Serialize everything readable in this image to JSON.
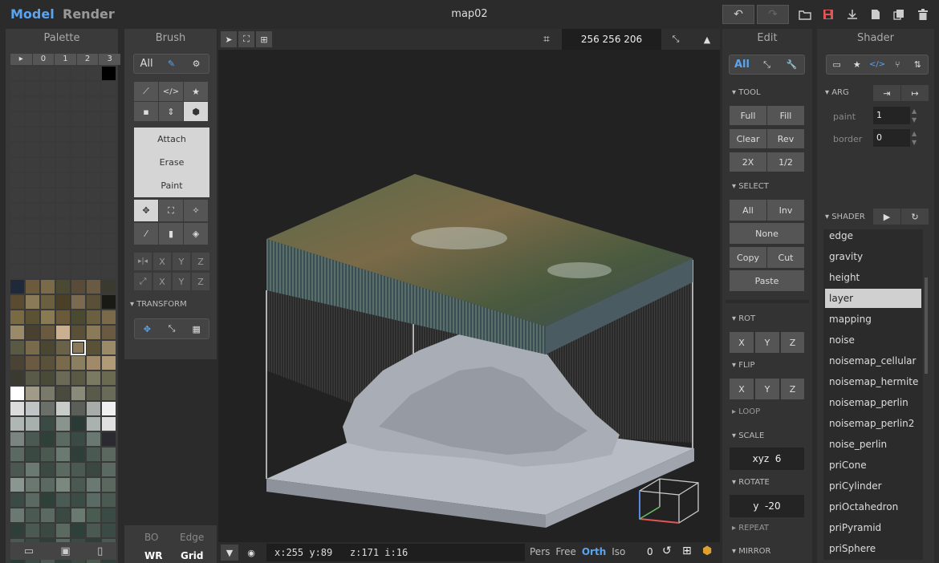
{
  "topbar": {
    "mode_model": "Model",
    "mode_render": "Render",
    "title": "map02"
  },
  "palette": {
    "title": "Palette",
    "tabs": [
      "▸",
      "0",
      "1",
      "2",
      "3"
    ],
    "colors": [
      "#3c3c3c",
      "#3c3c3c",
      "#3c3c3c",
      "#3c3c3c",
      "#3c3c3c",
      "#3c3c3c",
      "#000000",
      "#3c3c3c",
      "#3c3c3c",
      "#3c3c3c",
      "#3c3c3c",
      "#3c3c3c",
      "#3c3c3c",
      "#3c3c3c",
      "#3c3c3c",
      "#3c3c3c",
      "#3c3c3c",
      "#3c3c3c",
      "#3c3c3c",
      "#3c3c3c",
      "#3c3c3c",
      "#3c3c3c",
      "#3c3c3c",
      "#3c3c3c",
      "#3c3c3c",
      "#3c3c3c",
      "#3c3c3c",
      "#3c3c3c",
      "#3c3c3c",
      "#3c3c3c",
      "#3c3c3c",
      "#3c3c3c",
      "#3c3c3c",
      "#3c3c3c",
      "#3c3c3c",
      "#3c3c3c",
      "#3c3c3c",
      "#3c3c3c",
      "#3c3c3c",
      "#3c3c3c",
      "#3c3c3c",
      "#3c3c3c",
      "#3c3c3c",
      "#3c3c3c",
      "#3c3c3c",
      "#3c3c3c",
      "#3c3c3c",
      "#3c3c3c",
      "#3c3c3c",
      "#3c3c3c",
      "#3c3c3c",
      "#3c3c3c",
      "#3c3c3c",
      "#3c3c3c",
      "#3c3c3c",
      "#3c3c3c",
      "#3c3c3c",
      "#3c3c3c",
      "#3c3c3c",
      "#3c3c3c",
      "#3c3c3c",
      "#3c3c3c",
      "#3c3c3c",
      "#3c3c3c",
      "#3c3c3c",
      "#3c3c3c",
      "#3c3c3c",
      "#3c3c3c",
      "#3c3c3c",
      "#3c3c3c",
      "#3c3c3c",
      "#3c3c3c",
      "#3c3c3c",
      "#3c3c3c",
      "#3c3c3c",
      "#3c3c3c",
      "#3c3c3c",
      "#3c3c3c",
      "#3c3c3c",
      "#3c3c3c",
      "#3c3c3c",
      "#3c3c3c",
      "#3c3c3c",
      "#3c3c3c",
      "#3c3c3c",
      "#3c3c3c",
      "#3c3c3c",
      "#3c3c3c",
      "#3c3c3c",
      "#3c3c3c",
      "#3c3c3c",
      "#3c3c3c",
      "#3c3c3c",
      "#3c3c3c",
      "#3c3c3c",
      "#3c3c3c",
      "#3c3c3c",
      "#3c3c3c",
      "#1e2a3c",
      "#6b5a3c",
      "#7a6a48",
      "#4a4a32",
      "#5a4a38",
      "#6a5a42",
      "#3a3a30",
      "#5a4a30",
      "#8a7a58",
      "#6a6040",
      "#4a4028",
      "#7a6a50",
      "#5a5038",
      "#1a1a14",
      "#7a6a42",
      "#5a5232",
      "#8a7a52",
      "#6a5a3a",
      "#4a4a30",
      "#6a6040",
      "#7a6a4a",
      "#9a8a6a",
      "#4a4030",
      "#6a5a40",
      "#c8b090",
      "#5a5038",
      "#8a7a58",
      "#6a5a42",
      "#5a5a42",
      "#7a6a4c",
      "#4a4632",
      "#6a6248",
      "#8a7a5a",
      "#5a5236",
      "#9a8a68",
      "#4a4232",
      "#6a5a42",
      "#5a5238",
      "#7a6a4c",
      "#8a8060",
      "#a08a6a",
      "#b09a78",
      "#3a3a30",
      "#5a5a48",
      "#4a4a38",
      "#6a6a56",
      "#5a5a44",
      "#7a7a62",
      "#6a6a50",
      "#ffffff",
      "#a09a88",
      "#7a7a6a",
      "#4a4a3e",
      "#8a8a78",
      "#5a5a4a",
      "#6a6a58",
      "#dcdcdc",
      "#c0c4c4",
      "#6a7068",
      "#c8ccc8",
      "#5a6058",
      "#a8aca8",
      "#f0f0f0",
      "#b0b6b4",
      "#a8b0ae",
      "#3a4a44",
      "#8a948e",
      "#2a3a34",
      "#aab2b0",
      "#e0e0e0",
      "#7a8480",
      "#4a5a52",
      "#2e4038",
      "#5a6a62",
      "#3a4a44",
      "#6a7872",
      "#2a2a30",
      "#5a6a62",
      "#3a4a42",
      "#4a5a50",
      "#6a7a72",
      "#2e3e38",
      "#4a5a52",
      "#5a6860",
      "#4a5850",
      "#6a7a70",
      "#3a4a42",
      "#5a6a60",
      "#4a5a50",
      "#3a4840",
      "#5a6a62",
      "#8a9690",
      "#6a7870",
      "#5a6a62",
      "#7a8880",
      "#4a5a52",
      "#6a7a72",
      "#5a6860",
      "#3a4a44",
      "#5a6a62",
      "#2e403a",
      "#4a5a54",
      "#3a4c44",
      "#5a6a64",
      "#4a5a52",
      "#6a7a72",
      "#4a5a52",
      "#5a6a62",
      "#3a4a42",
      "#6a7a70",
      "#4a5c52",
      "#3a4a44",
      "#2e3e38",
      "#4a5a50",
      "#3a4a42",
      "#5a6a60",
      "#2e403a",
      "#4a5a52",
      "#3a4a44",
      "#4a5a52",
      "#3a4a42",
      "#2e3e38",
      "#5a6a62",
      "#3a4a44",
      "#2e3e38",
      "#4a5a52",
      "#2a3a34",
      "#3a4a44",
      "#4a5a52",
      "#2e3e38",
      "#3a4a42",
      "#4a5a50",
      "#2e3e38",
      "#3a4a44",
      "#2a3a34",
      "#3a4a42",
      "#4a5a52",
      "#2e3e38",
      "#3a4a44",
      "#2a3a34"
    ],
    "selected_index": 130
  },
  "brush": {
    "title": "Brush",
    "filter_all": "All",
    "attach": "Attach",
    "erase": "Erase",
    "paint": "Paint",
    "axis_x": "X",
    "axis_y": "Y",
    "axis_z": "Z",
    "transform": "TRANSFORM",
    "bo": "BO",
    "edge": "Edge",
    "wr": "WR",
    "grid": "Grid"
  },
  "viewport": {
    "dims": "256  256  206",
    "status": "x:255 y:89   z:171 i:16",
    "proj": [
      "Pers",
      "Free",
      "Orth",
      "Iso"
    ],
    "proj_active": "Orth",
    "zero": "0",
    "colors": {
      "accent": "#5aa4f0",
      "red": "#e05555"
    }
  },
  "edit": {
    "title": "Edit",
    "all": "All",
    "tool": "TOOL",
    "full": "Full",
    "fill": "Fill",
    "clear": "Clear",
    "rev": "Rev",
    "x2": "2X",
    "half": "1/2",
    "select": "SELECT",
    "sel_all": "All",
    "inv": "Inv",
    "none": "None",
    "copy": "Copy",
    "cut": "Cut",
    "paste": "Paste",
    "rot": "ROT",
    "flip": "FLIP",
    "x": "X",
    "y": "Y",
    "z": "Z",
    "loop": "LOOP",
    "scale": "SCALE",
    "scale_val": "xyz  6",
    "rotate": "ROTATE",
    "rotate_val": "y  -20",
    "repeat": "REPEAT",
    "mirror": "MIRROR"
  },
  "shader": {
    "title": "Shader",
    "arg": "ARG",
    "paint_label": "paint",
    "paint_val": "1",
    "border_label": "border",
    "border_val": "0",
    "shader_label": "SHADER",
    "items": [
      "edge",
      "gravity",
      "height",
      "layer",
      "mapping",
      "noise",
      "noisemap_cellular",
      "noisemap_hermite",
      "noisemap_perlin",
      "noisemap_perlin2",
      "noise_perlin",
      "priCone",
      "priCylinder",
      "priOctahedron",
      "priPyramid",
      "priSphere"
    ],
    "selected": "layer"
  }
}
